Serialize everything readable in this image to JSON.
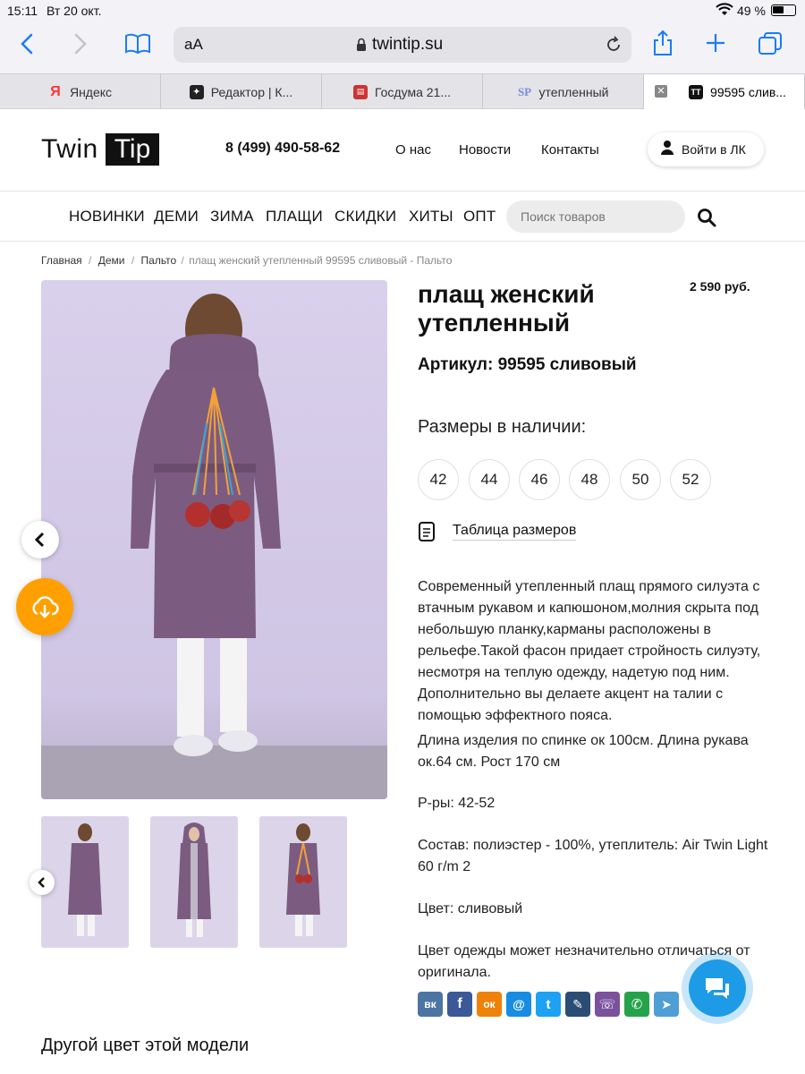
{
  "status_bar": {
    "time": "15:11",
    "date": "Вт 20 окт.",
    "battery": "49 %"
  },
  "browser": {
    "text_size_label": "аА",
    "url": "twintip.su",
    "tabs": [
      {
        "label": "Яндекс",
        "icon": "yandex-icon",
        "active": false
      },
      {
        "label": "Редактор | К...",
        "icon": "editor-icon",
        "active": false
      },
      {
        "label": "Госдума 21...",
        "icon": "news-icon",
        "active": false
      },
      {
        "label": "утепленный",
        "icon": "sp-icon",
        "active": false
      },
      {
        "label": "99595 слив...",
        "icon": "twintip-icon",
        "active": true
      }
    ]
  },
  "header": {
    "logo_left": "Twin",
    "logo_right": "Tip",
    "phone": "8 (499) 490-58-62",
    "links": [
      "О нас",
      "Новости",
      "Контакты"
    ],
    "login_label": "Войти в ЛК"
  },
  "nav": {
    "items": [
      "НОВИНКИ",
      "ДЕМИ",
      "ЗИМА",
      "ПЛАЩИ",
      "СКИДКИ",
      "ХИТЫ",
      "ОПТ"
    ],
    "search_placeholder": "Поиск товаров"
  },
  "breadcrumb": {
    "items": [
      "Главная",
      "Деми",
      "Пальто"
    ],
    "current": "плащ женский утепленный 99595 сливовый - Пальто"
  },
  "product": {
    "title_line1": "плащ женский",
    "title_line2": "утепленный",
    "price": "2 590 руб.",
    "article": "Артикул: 99595 сливовый",
    "sizes_label": "Размеры в наличии:",
    "sizes": [
      "42",
      "44",
      "46",
      "48",
      "50",
      "52"
    ],
    "size_table_label": "Таблица размеров",
    "description": [
      "Современный утепленный плащ прямого силуэта с втачным рукавом и капюшоном,молния скрыта под небольшую планку,карманы расположены в рельефе.Такой фасон придает стройность силуэту, несмотря на теплую одежду, надетую под ним. Дополнительно вы делаете акцент на талии с помощью эффектного пояса.",
      "Длина изделия по спинке ок 100см. Длина рукава  ок.64 см. Рост 170 см",
      "Р-ры: 42-52",
      "Состав: полиэстер - 100%, утеплитель: Air Twin Light 60 г/m 2",
      "Цвет: сливовый",
      "Цвет одежды может незначительно отличаться от оригинала."
    ],
    "share": [
      {
        "name": "vk-icon",
        "glyph": "вк",
        "color": "#4c75a3"
      },
      {
        "name": "facebook-icon",
        "glyph": "f",
        "color": "#3b5998"
      },
      {
        "name": "odnoklassniki-icon",
        "glyph": "ок",
        "color": "#ee8208"
      },
      {
        "name": "moimir-icon",
        "glyph": "@",
        "color": "#168de2"
      },
      {
        "name": "twitter-icon",
        "glyph": "t",
        "color": "#1da1f2"
      },
      {
        "name": "livejournal-icon",
        "glyph": "✎",
        "color": "#2b4d74"
      },
      {
        "name": "viber-icon",
        "glyph": "☏",
        "color": "#7b519d"
      },
      {
        "name": "whatsapp-icon",
        "glyph": "✆",
        "color": "#25a34a"
      },
      {
        "name": "telegram-icon",
        "glyph": "➤",
        "color": "#4f9fd6"
      }
    ]
  },
  "other_color_heading": "Другой цвет этой модели",
  "colors": {
    "accent_orange": "#ffa000",
    "chat_blue": "#1e9be6",
    "coat_plum": "#7a5a7e"
  }
}
